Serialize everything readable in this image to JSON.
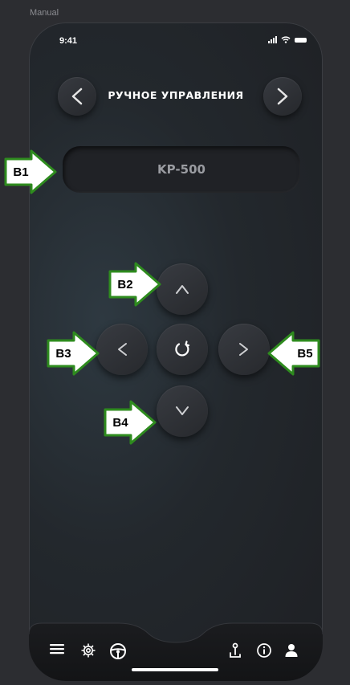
{
  "frame_label": "Manual",
  "status": {
    "time": "9:41"
  },
  "header": {
    "title": "РУЧНОЕ УПРАВЛЕНИЯ"
  },
  "device": {
    "name": "KP-500"
  },
  "callouts": {
    "b1": "B1",
    "b2": "B2",
    "b3": "B3",
    "b4": "B4",
    "b5": "B5"
  },
  "colors": {
    "accent": "#ffffff",
    "callout_fill": "#ffffff",
    "callout_border": "#2e8b1e",
    "background": "#1e2024"
  },
  "icons": [
    "chevron-left-icon",
    "chevron-right-icon",
    "arrow-up-icon",
    "arrow-down-icon",
    "arrow-left-icon",
    "arrow-right-icon",
    "rotate-icon",
    "menu-icon",
    "settings-gear-icon",
    "steering-wheel-icon",
    "joystick-icon",
    "info-icon",
    "user-icon",
    "signal-icon",
    "wifi-icon",
    "battery-icon"
  ]
}
